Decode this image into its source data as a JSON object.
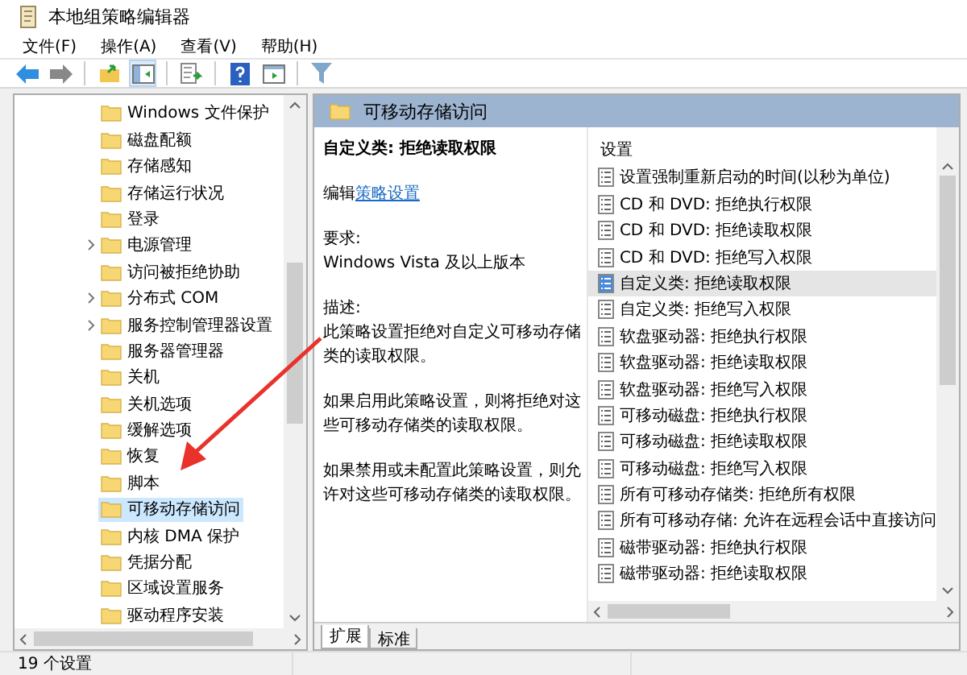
{
  "window": {
    "title": "本地组策略编辑器"
  },
  "menu": [
    {
      "label": "文件(F)"
    },
    {
      "label": "操作(A)"
    },
    {
      "label": "查看(V)"
    },
    {
      "label": "帮助(H)"
    }
  ],
  "toolbar": [
    {
      "kind": "back",
      "pressed": false
    },
    {
      "kind": "forward",
      "pressed": false
    },
    {
      "kind": "sep"
    },
    {
      "kind": "up",
      "pressed": false
    },
    {
      "kind": "tree",
      "pressed": true
    },
    {
      "kind": "sep"
    },
    {
      "kind": "export",
      "pressed": false
    },
    {
      "kind": "sep"
    },
    {
      "kind": "help",
      "pressed": false
    },
    {
      "kind": "pane",
      "pressed": false
    },
    {
      "kind": "sep"
    },
    {
      "kind": "filter",
      "pressed": false
    }
  ],
  "tree": [
    {
      "label": "Windows 文件保护",
      "expandable": false,
      "selected": false
    },
    {
      "label": "磁盘配额",
      "expandable": false,
      "selected": false
    },
    {
      "label": "存储感知",
      "expandable": false,
      "selected": false
    },
    {
      "label": "存储运行状况",
      "expandable": false,
      "selected": false
    },
    {
      "label": "登录",
      "expandable": false,
      "selected": false
    },
    {
      "label": "电源管理",
      "expandable": true,
      "selected": false
    },
    {
      "label": "访问被拒绝协助",
      "expandable": false,
      "selected": false
    },
    {
      "label": "分布式 COM",
      "expandable": true,
      "selected": false
    },
    {
      "label": "服务控制管理器设置",
      "expandable": true,
      "selected": false
    },
    {
      "label": "服务器管理器",
      "expandable": false,
      "selected": false
    },
    {
      "label": "关机",
      "expandable": false,
      "selected": false
    },
    {
      "label": "关机选项",
      "expandable": false,
      "selected": false
    },
    {
      "label": "缓解选项",
      "expandable": false,
      "selected": false
    },
    {
      "label": "恢复",
      "expandable": false,
      "selected": false
    },
    {
      "label": "脚本",
      "expandable": false,
      "selected": false
    },
    {
      "label": "可移动存储访问",
      "expandable": false,
      "selected": true
    },
    {
      "label": "内核 DMA 保护",
      "expandable": false,
      "selected": false
    },
    {
      "label": "凭据分配",
      "expandable": false,
      "selected": false
    },
    {
      "label": "区域设置服务",
      "expandable": false,
      "selected": false
    },
    {
      "label": "驱动程序安装",
      "expandable": false,
      "selected": false
    }
  ],
  "details": {
    "header": "可移动存储访问",
    "title": "自定义类: 拒绝读取权限",
    "edit_prefix": "编辑",
    "edit_link": "策略设置",
    "requirements_label": "要求:",
    "requirements": "Windows Vista 及以上版本",
    "description_label": "描述:",
    "paragraphs": [
      "此策略设置拒绝对自定义可移动存储类的读取权限。",
      "如果启用此策略设置，则将拒绝对这些可移动存储类的读取权限。",
      "如果禁用或未配置此策略设置，则允许对这些可移动存储类的读取权限。"
    ]
  },
  "settings": {
    "column": "设置",
    "rows": [
      {
        "label": "设置强制重新启动的时间(以秒为单位)",
        "selected": false
      },
      {
        "label": "CD 和 DVD: 拒绝执行权限",
        "selected": false
      },
      {
        "label": "CD 和 DVD: 拒绝读取权限",
        "selected": false
      },
      {
        "label": "CD 和 DVD: 拒绝写入权限",
        "selected": false
      },
      {
        "label": "自定义类: 拒绝读取权限",
        "selected": true
      },
      {
        "label": "自定义类: 拒绝写入权限",
        "selected": false
      },
      {
        "label": "软盘驱动器: 拒绝执行权限",
        "selected": false
      },
      {
        "label": "软盘驱动器: 拒绝读取权限",
        "selected": false
      },
      {
        "label": "软盘驱动器: 拒绝写入权限",
        "selected": false
      },
      {
        "label": "可移动磁盘: 拒绝执行权限",
        "selected": false
      },
      {
        "label": "可移动磁盘: 拒绝读取权限",
        "selected": false
      },
      {
        "label": "可移动磁盘: 拒绝写入权限",
        "selected": false
      },
      {
        "label": "所有可移动存储类: 拒绝所有权限",
        "selected": false
      },
      {
        "label": "所有可移动存储: 允许在远程会话中直接访问",
        "selected": false
      },
      {
        "label": "磁带驱动器: 拒绝执行权限",
        "selected": false
      },
      {
        "label": "磁带驱动器: 拒绝读取权限",
        "selected": false
      }
    ]
  },
  "tabs": [
    {
      "label": "扩展",
      "selected": true
    },
    {
      "label": "标准",
      "selected": false
    }
  ],
  "status_bar": {
    "text": "19 个设置"
  }
}
